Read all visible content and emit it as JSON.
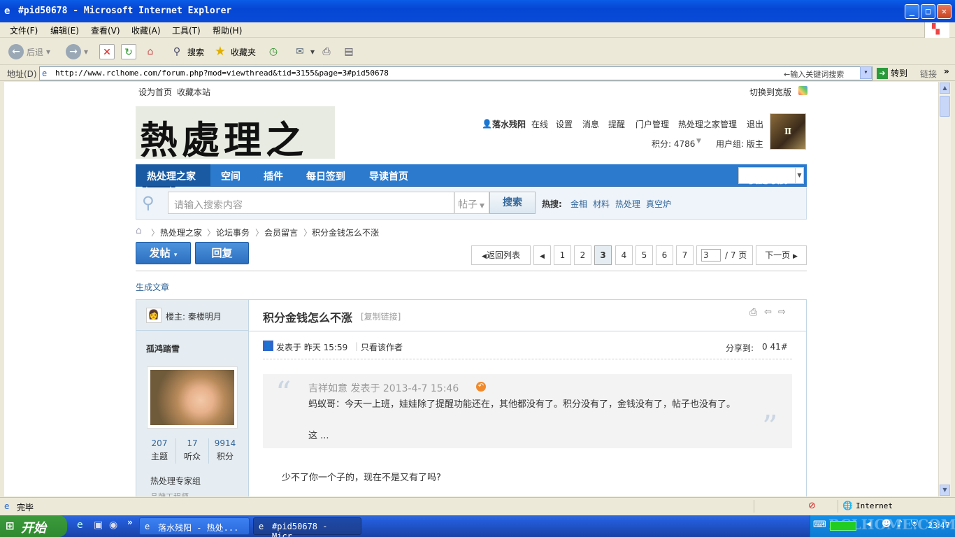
{
  "window": {
    "title": "#pid50678 - Microsoft Internet Explorer"
  },
  "menu": [
    "文件(F)",
    "编辑(E)",
    "查看(V)",
    "收藏(A)",
    "工具(T)",
    "帮助(H)"
  ],
  "toolbar": {
    "back": "后退",
    "search": "搜索",
    "favorites": "收藏夹"
  },
  "address": {
    "label": "地址(D)",
    "url": "http://www.rclhome.com/forum.php?mod=viewthread&tid=3155&page=3#pid50678",
    "keyword_hint": "←输入关键词搜索",
    "go": "转到",
    "links": "链接"
  },
  "site": {
    "top_links": [
      "设为首页",
      "收藏本站"
    ],
    "wide_toggle": "切换到宽版",
    "logo_text": "熱處理之家",
    "user": {
      "name": "落水残阳",
      "status": "在线",
      "links": [
        "设置",
        "消息",
        "提醒",
        "门户管理",
        "热处理之家管理",
        "退出"
      ],
      "points": "积分: 4786",
      "group": "用户组: 版主"
    },
    "nav": [
      "热处理之家",
      "空间",
      "插件",
      "每日签到",
      "导读首页"
    ],
    "quick_nav": "快捷导航",
    "search": {
      "placeholder": "请输入搜索内容",
      "scope": "帖子",
      "button": "搜索",
      "hot_label": "热搜:",
      "hot": [
        "金相",
        "材料",
        "热处理",
        "真空炉"
      ]
    },
    "breadcrumb": [
      "热处理之家",
      "论坛事务",
      "会员留言",
      "积分金钱怎么不涨"
    ],
    "actions": {
      "post": "发帖",
      "reply": "回复",
      "back_list": "返回列表",
      "pages": [
        "1",
        "2",
        "3",
        "4",
        "5",
        "6",
        "7"
      ],
      "current_page": "3",
      "page_total": "/ 7 页",
      "next": "下一页"
    },
    "gen_article": "生成文章",
    "thread": {
      "owner_label": "楼主: 秦楼明月",
      "title": "积分金钱怎么不涨",
      "copy_link": "[复制链接]",
      "author": "孤鸿踏雪",
      "stats": [
        {
          "value": "207",
          "label": "主题"
        },
        {
          "value": "17",
          "label": "听众"
        },
        {
          "value": "9914",
          "label": "积分"
        }
      ],
      "group": "热处理专家组",
      "rank": "品牌工程师",
      "posted": "发表于 昨天 15:59",
      "only_author": "只看该作者",
      "share": "分享到:",
      "floor": "0 41#",
      "quote_head": "吉祥如意 发表于 2013-4-7 15:46",
      "quote_body": "蚂蚁哥：今天一上班，娃娃除了提醒功能还在，其他都没有了。积分没有了，金钱没有了，帖子也没有了。",
      "quote_more": "这 ...",
      "reply": "少不了你一个子的，现在不是又有了吗?"
    }
  },
  "status": {
    "text": "完毕",
    "zone": "Internet"
  },
  "taskbar": {
    "start": "开始",
    "tasks": [
      "落水残阳 - 热处...",
      "#pid50678 - Micr..."
    ],
    "clock": "23:47",
    "watermark": "RCLHOME.COM"
  }
}
